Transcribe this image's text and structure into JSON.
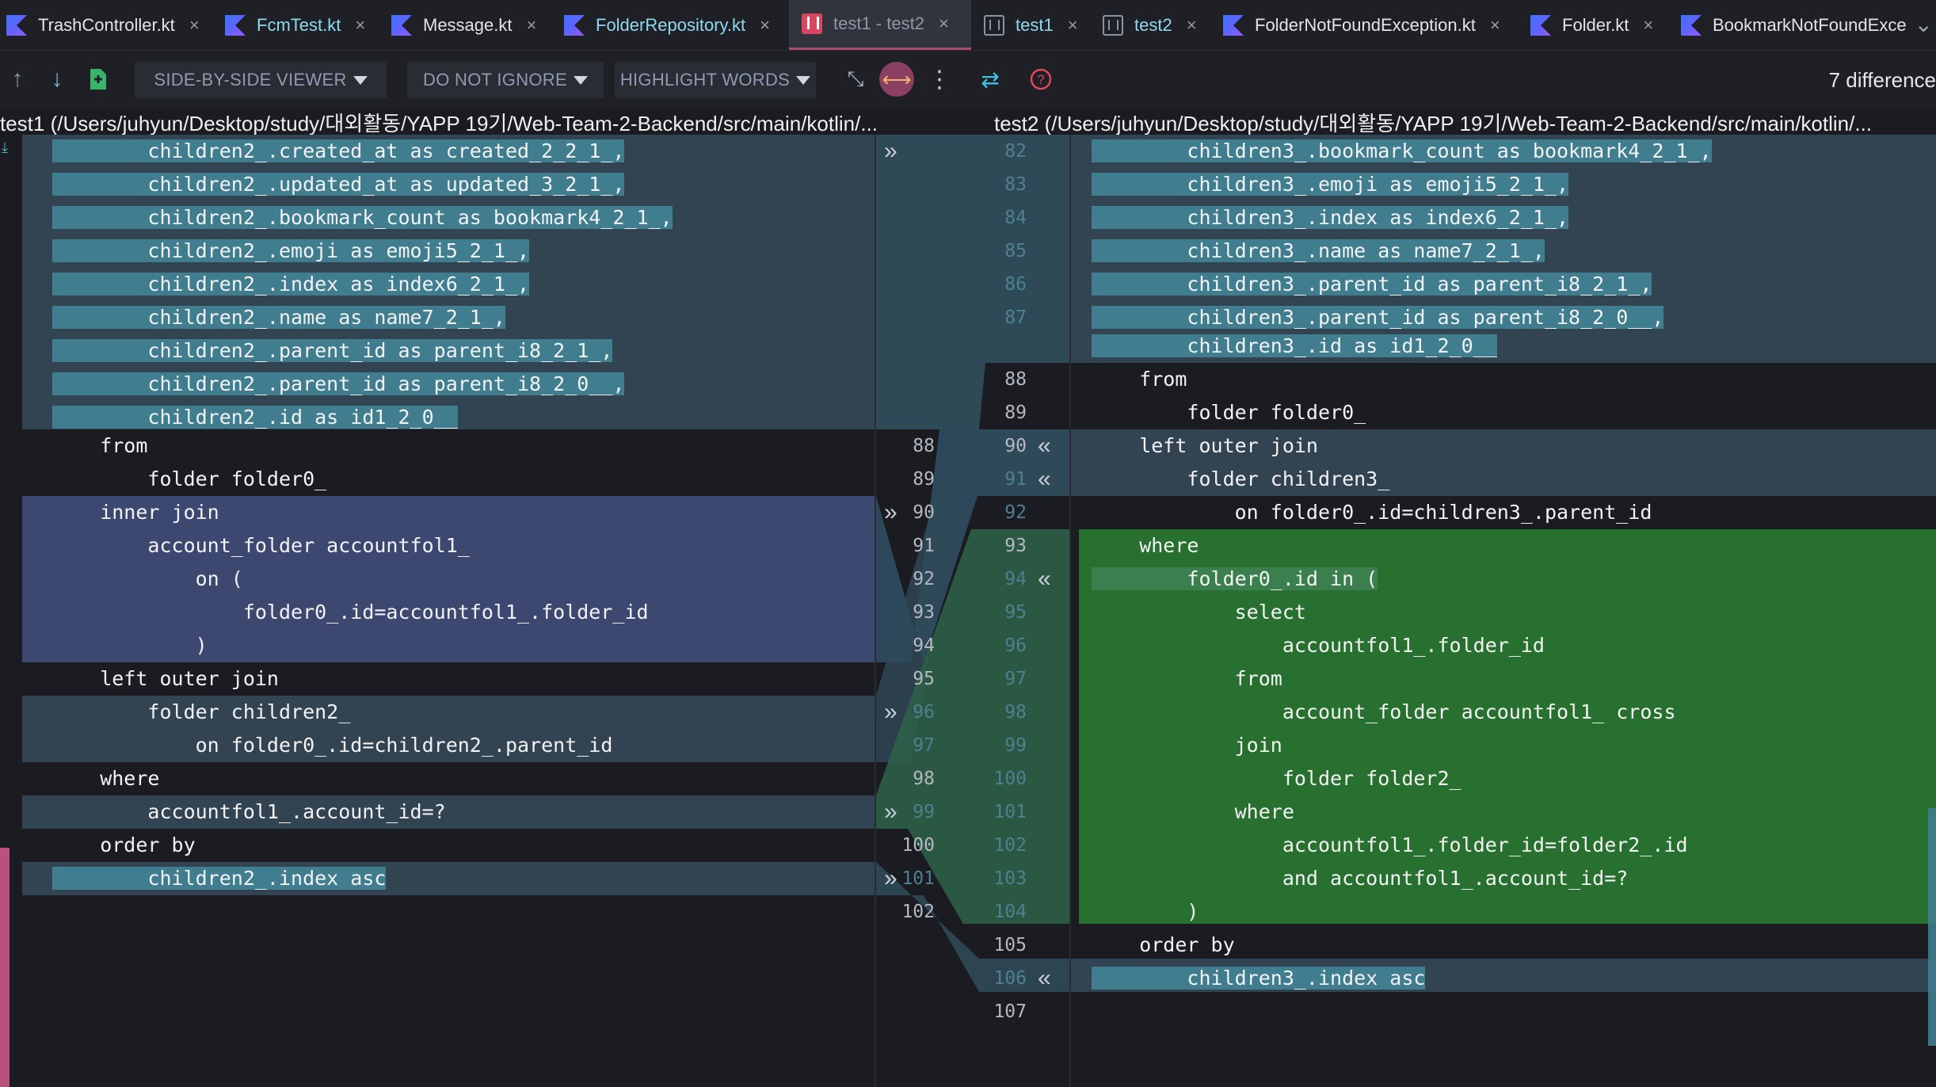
{
  "tabs": [
    {
      "label": "TrashController.kt",
      "icon": "kotlin-file-icon",
      "color": "#e4e4e4"
    },
    {
      "label": "FcmTest.kt",
      "icon": "kotlin-file-icon",
      "color": "#8fd9ee"
    },
    {
      "label": "Message.kt",
      "icon": "kotlin-file-icon",
      "color": "#e4e4e4"
    },
    {
      "label": "FolderRepository.kt",
      "icon": "kotlin-file-icon",
      "color": "#8fd9ee"
    },
    {
      "label": "test1 - test2",
      "icon": "diff-icon",
      "color": "#8d97a8"
    },
    {
      "label": "test1",
      "icon": "text-file-icon",
      "color": "#8fd9ee"
    },
    {
      "label": "test2",
      "icon": "text-file-icon",
      "color": "#8fd9ee"
    },
    {
      "label": "FolderNotFoundException.kt",
      "icon": "kotlin-file-icon",
      "color": "#e4e4e4"
    },
    {
      "label": "Folder.kt",
      "icon": "kotlin-file-icon",
      "color": "#e4e4e4"
    },
    {
      "label": "BookmarkNotFoundExce",
      "icon": "kotlin-file-icon",
      "color": "#e4e4e4"
    }
  ],
  "toolbar": {
    "viewer_label": "SIDE-BY-SIDE VIEWER",
    "ignore_label": "DO NOT IGNORE",
    "highlight_label": "HIGHLIGHT WORDS",
    "difference_count": "7 difference"
  },
  "paths": {
    "left": "test1 (/Users/juhyun/Desktop/study/대외활동/YAPP 19기/Web-Team-2-Backend/src/main/kotlin/...",
    "right": "test2 (/Users/juhyun/Desktop/study/대외활동/YAPP 19기/Web-Team-2-Backend/src/main/kotlin/..."
  },
  "left": {
    "lines": [
      "        children2_.created_at as created_2_2_1_,",
      "        children2_.updated_at as updated_3_2_1_,",
      "        children2_.bookmark_count as bookmark4_2_1_,",
      "        children2_.emoji as emoji5_2_1_,",
      "        children2_.index as index6_2_1_,",
      "        children2_.name as name7_2_1_,",
      "        children2_.parent_id as parent_i8_2_1_,",
      "        children2_.parent_id as parent_i8_2_0__,",
      "        children2_.id as id1_2_0__",
      "    from",
      "        folder folder0_",
      "    inner join",
      "        account_folder accountfol1_",
      "            on (",
      "                folder0_.id=accountfol1_.folder_id",
      "            )",
      "    left outer join",
      "        folder children2_",
      "            on folder0_.id=children2_.parent_id",
      "    where",
      "        accountfol1_.account_id=?",
      "    order by",
      "        children2_.index asc"
    ],
    "numbers": [
      "88",
      "89",
      "90",
      "91",
      "92",
      "93",
      "94",
      "95",
      "96",
      "97",
      "98",
      "99",
      "100",
      "101",
      "102"
    ]
  },
  "right": {
    "lines": [
      "        children3_.bookmark_count as bookmark4_2_1_,",
      "        children3_.emoji as emoji5_2_1_,",
      "        children3_.index as index6_2_1_,",
      "        children3_.name as name7_2_1_,",
      "        children3_.parent_id as parent_i8_2_1_,",
      "        children3_.parent_id as parent_i8_2_0__,",
      "        children3_.id as id1_2_0__",
      "    from",
      "        folder folder0_",
      "    left outer join",
      "        folder children3_",
      "            on folder0_.id=children3_.parent_id",
      "    where",
      "        folder0_.id in (",
      "            select",
      "                accountfol1_.folder_id",
      "            from",
      "                account_folder accountfol1_ cross",
      "            join",
      "                folder folder2_",
      "            where",
      "                accountfol1_.folder_id=folder2_.id",
      "                and accountfol1_.account_id=?",
      "        )",
      "    order by",
      "        children3_.index asc"
    ],
    "numbers": [
      "82",
      "83",
      "84",
      "85",
      "86",
      "87",
      "88",
      "89",
      "90",
      "91",
      "92",
      "93",
      "94",
      "95",
      "96",
      "97",
      "98",
      "99",
      "100",
      "101",
      "102",
      "103",
      "104",
      "105",
      "106",
      "107"
    ]
  },
  "colors": {
    "changed": "#3f7d8f",
    "inserted": "#3a7f4d",
    "deleted_block": "#3c4870",
    "modified_row": "#324452",
    "background": "#1b1c22"
  }
}
